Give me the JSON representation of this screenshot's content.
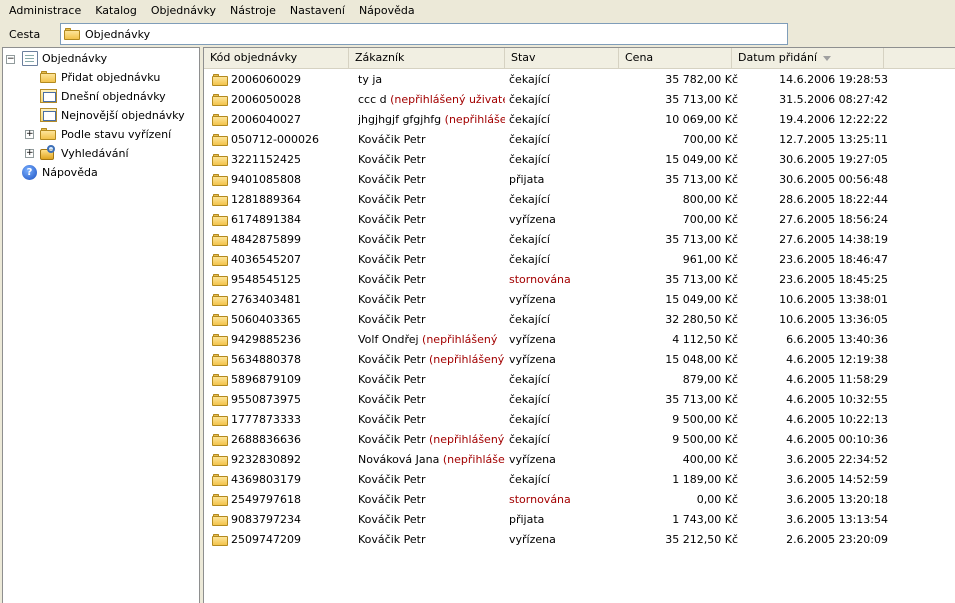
{
  "menubar": {
    "items": [
      "Administrace",
      "Katalog",
      "Objednávky",
      "Nástroje",
      "Nastavení",
      "Nápověda"
    ]
  },
  "pathbar": {
    "label": "Cesta",
    "value": "Objednávky"
  },
  "tree": {
    "root": "Objednávky",
    "expander_collapse": "−",
    "expander_expand": "+",
    "children": [
      "Přidat objednávku",
      "Dnešní objednávky",
      "Nejnovější objednávky",
      "Podle stavu vyřízení",
      "Vyhledávání"
    ],
    "help": "Nápověda",
    "help_glyph": "?"
  },
  "list": {
    "columns": [
      "Kód objednávky",
      "Zákazník",
      "Stav",
      "Cena",
      "Datum přidání"
    ],
    "sort_column": "Datum přidání",
    "sort_direction": "descending",
    "highlight_color": "#a20000",
    "rows": [
      {
        "code": "2006060029",
        "customer": "ty ja",
        "customer_note": "",
        "state": "čekající",
        "state_red": false,
        "price": "35 782,00 Kč",
        "date": "14.6.2006 19:28:53"
      },
      {
        "code": "2006050028",
        "customer": "ccc d",
        "customer_note": "(nepřihlášený uživatel)",
        "state": "čekající",
        "state_red": false,
        "price": "35 713,00 Kč",
        "date": "31.5.2006 08:27:42"
      },
      {
        "code": "2006040027",
        "customer": "jhgjhgjf gfgjhfg",
        "customer_note": "(nepřihlášený",
        "state": "čekající",
        "state_red": false,
        "price": "10 069,00 Kč",
        "date": "19.4.2006 12:22:22"
      },
      {
        "code": "050712-000026",
        "customer": "Kováčik Petr",
        "customer_note": "",
        "state": "čekající",
        "state_red": false,
        "price": "700,00 Kč",
        "date": "12.7.2005 13:25:11"
      },
      {
        "code": "3221152425",
        "customer": "Kováčik Petr",
        "customer_note": "",
        "state": "čekající",
        "state_red": false,
        "price": "15 049,00 Kč",
        "date": "30.6.2005 19:27:05"
      },
      {
        "code": "9401085808",
        "customer": "Kováčik Petr",
        "customer_note": "",
        "state": "přijata",
        "state_red": false,
        "price": "35 713,00 Kč",
        "date": "30.6.2005 00:56:48"
      },
      {
        "code": "1281889364",
        "customer": "Kováčik Petr",
        "customer_note": "",
        "state": "čekající",
        "state_red": false,
        "price": "800,00 Kč",
        "date": "28.6.2005 18:22:44"
      },
      {
        "code": "6174891384",
        "customer": "Kováčik Petr",
        "customer_note": "",
        "state": "vyřízena",
        "state_red": false,
        "price": "700,00 Kč",
        "date": "27.6.2005 18:56:24"
      },
      {
        "code": "4842875899",
        "customer": "Kováčik Petr",
        "customer_note": "",
        "state": "čekající",
        "state_red": false,
        "price": "35 713,00 Kč",
        "date": "27.6.2005 14:38:19"
      },
      {
        "code": "4036545207",
        "customer": "Kováčik Petr",
        "customer_note": "",
        "state": "čekající",
        "state_red": false,
        "price": "961,00 Kč",
        "date": "23.6.2005 18:46:47"
      },
      {
        "code": "9548545125",
        "customer": "Kováčik Petr",
        "customer_note": "",
        "state": "stornována",
        "state_red": true,
        "price": "35 713,00 Kč",
        "date": "23.6.2005 18:45:25"
      },
      {
        "code": "2763403481",
        "customer": "Kováčik Petr",
        "customer_note": "",
        "state": "vyřízena",
        "state_red": false,
        "price": "15 049,00 Kč",
        "date": "10.6.2005 13:38:01"
      },
      {
        "code": "5060403365",
        "customer": "Kováčik Petr",
        "customer_note": "",
        "state": "čekající",
        "state_red": false,
        "price": "32 280,50 Kč",
        "date": "10.6.2005 13:36:05"
      },
      {
        "code": "9429885236",
        "customer": "Volf Ondřej",
        "customer_note": "(nepřihlášený",
        "state": "vyřízena",
        "state_red": false,
        "price": "4 112,50 Kč",
        "date": "6.6.2005 13:40:36"
      },
      {
        "code": "5634880378",
        "customer": "Kováčik Petr",
        "customer_note": "(nepřihlášený",
        "state": "vyřízena",
        "state_red": false,
        "price": "15 048,00 Kč",
        "date": "4.6.2005 12:19:38"
      },
      {
        "code": "5896879109",
        "customer": "Kováčik Petr",
        "customer_note": "",
        "state": "čekající",
        "state_red": false,
        "price": "879,00 Kč",
        "date": "4.6.2005 11:58:29"
      },
      {
        "code": "9550873975",
        "customer": "Kováčik Petr",
        "customer_note": "",
        "state": "čekající",
        "state_red": false,
        "price": "35 713,00 Kč",
        "date": "4.6.2005 10:32:55"
      },
      {
        "code": "1777873333",
        "customer": "Kováčik Petr",
        "customer_note": "",
        "state": "čekající",
        "state_red": false,
        "price": "9 500,00 Kč",
        "date": "4.6.2005 10:22:13"
      },
      {
        "code": "2688836636",
        "customer": "Kováčik Petr",
        "customer_note": "(nepřihlášený",
        "state": "čekající",
        "state_red": false,
        "price": "9 500,00 Kč",
        "date": "4.6.2005 00:10:36"
      },
      {
        "code": "9232830892",
        "customer": "Nováková Jana",
        "customer_note": "(nepřihlášený",
        "state": "vyřízena",
        "state_red": false,
        "price": "400,00 Kč",
        "date": "3.6.2005 22:34:52"
      },
      {
        "code": "4369803179",
        "customer": "Kováčik Petr",
        "customer_note": "",
        "state": "čekající",
        "state_red": false,
        "price": "1 189,00 Kč",
        "date": "3.6.2005 14:52:59"
      },
      {
        "code": "2549797618",
        "customer": "Kováčik Petr",
        "customer_note": "",
        "state": "stornována",
        "state_red": true,
        "price": "0,00 Kč",
        "date": "3.6.2005 13:20:18"
      },
      {
        "code": "9083797234",
        "customer": "Kováčik Petr",
        "customer_note": "",
        "state": "přijata",
        "state_red": false,
        "price": "1 743,00 Kč",
        "date": "3.6.2005 13:13:54"
      },
      {
        "code": "2509747209",
        "customer": "Kováčik Petr",
        "customer_note": "",
        "state": "vyřízena",
        "state_red": false,
        "price": "35 212,50 Kč",
        "date": "2.6.2005 23:20:09"
      }
    ]
  }
}
